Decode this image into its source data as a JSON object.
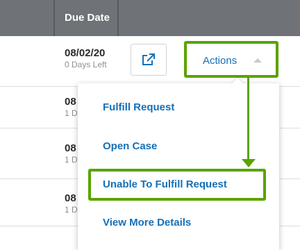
{
  "header": {
    "due_date_label": "Due Date"
  },
  "rows": [
    {
      "date": "08/02/20",
      "days_left": "0 Days Left"
    },
    {
      "date": "08",
      "days_left": "1 D"
    },
    {
      "date": "08",
      "days_left": "1 D"
    },
    {
      "date": "08",
      "days_left": "1 D"
    }
  ],
  "actions_button": {
    "label": "Actions"
  },
  "menu": {
    "items": [
      {
        "label": "Fulfill Request"
      },
      {
        "label": "Open Case"
      },
      {
        "label": "Unable To Fulfill Request"
      },
      {
        "label": "View More Details"
      }
    ]
  },
  "colors": {
    "header_bg": "#6f7377",
    "link": "#1470b8",
    "highlight": "#5aa300"
  },
  "icons": {
    "open_external": "open-external-icon",
    "caret": "caret-up-icon"
  }
}
